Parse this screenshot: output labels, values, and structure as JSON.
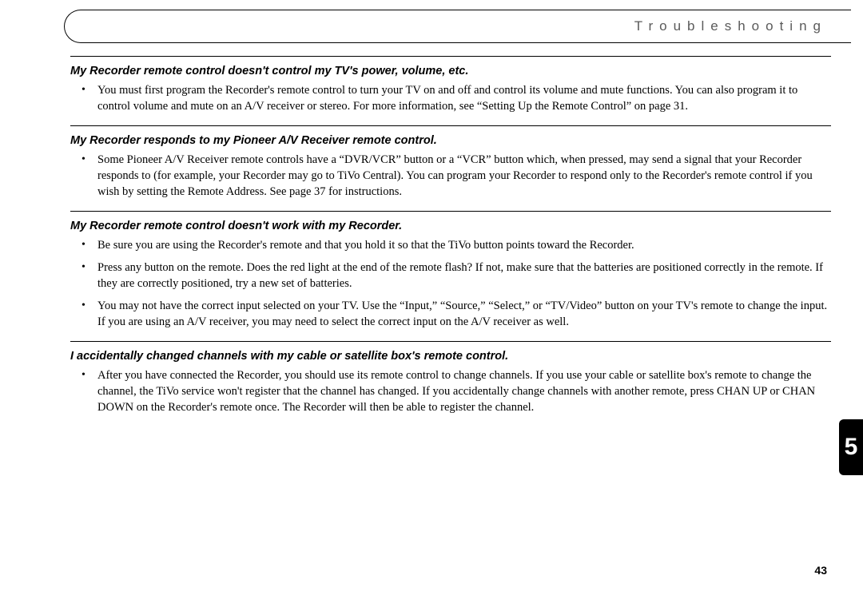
{
  "header": {
    "title": "Troubleshooting"
  },
  "sections": [
    {
      "heading": "My Recorder remote control doesn't control my TV's power, volume, etc.",
      "bullets": [
        "You must first program the Recorder's remote control to turn your TV on and off and control its volume and mute functions. You can also program it to control volume and mute on an A/V receiver or stereo. For more information, see “Setting Up the Remote Control” on page 31."
      ]
    },
    {
      "heading": "My Recorder responds to my Pioneer A/V Receiver remote control.",
      "bullets": [
        "Some Pioneer A/V Receiver remote controls have a “DVR/VCR” button or a “VCR” button which, when pressed, may send a signal that your Recorder responds to (for example, your Recorder may go to TiVo Central). You can program your Recorder to respond only to the Recorder's remote control if you wish by setting the Remote Address. See page 37 for instructions."
      ]
    },
    {
      "heading": "My Recorder remote control doesn't work with my Recorder.",
      "bullets": [
        "Be sure you are using the Recorder's remote and that you hold it so that the TiVo button points toward the Recorder.",
        "Press any button on the remote. Does the red light at the end of the remote flash? If not, make sure that the batteries are positioned correctly in the remote. If they are correctly positioned, try a new set of batteries.",
        "You may not have the correct input selected on your TV. Use the “Input,” “Source,” “Select,” or “TV/Video” button on your TV's remote to change the input. If you are using an A/V receiver, you may need to select the correct input on the A/V receiver as well."
      ]
    },
    {
      "heading": "I accidentally changed channels with my cable or satellite box's remote control.",
      "bullets": [
        "After you have connected the Recorder, you should use its remote control to change channels. If you use your cable or satellite box's remote to change the channel, the TiVo service won't register that the channel has changed. If you accidentally change channels with another remote, press CHAN UP or CHAN DOWN on the Recorder's remote once. The Recorder will then be able to register the channel."
      ]
    }
  ],
  "chapter_tab": "5",
  "page_number": "43"
}
